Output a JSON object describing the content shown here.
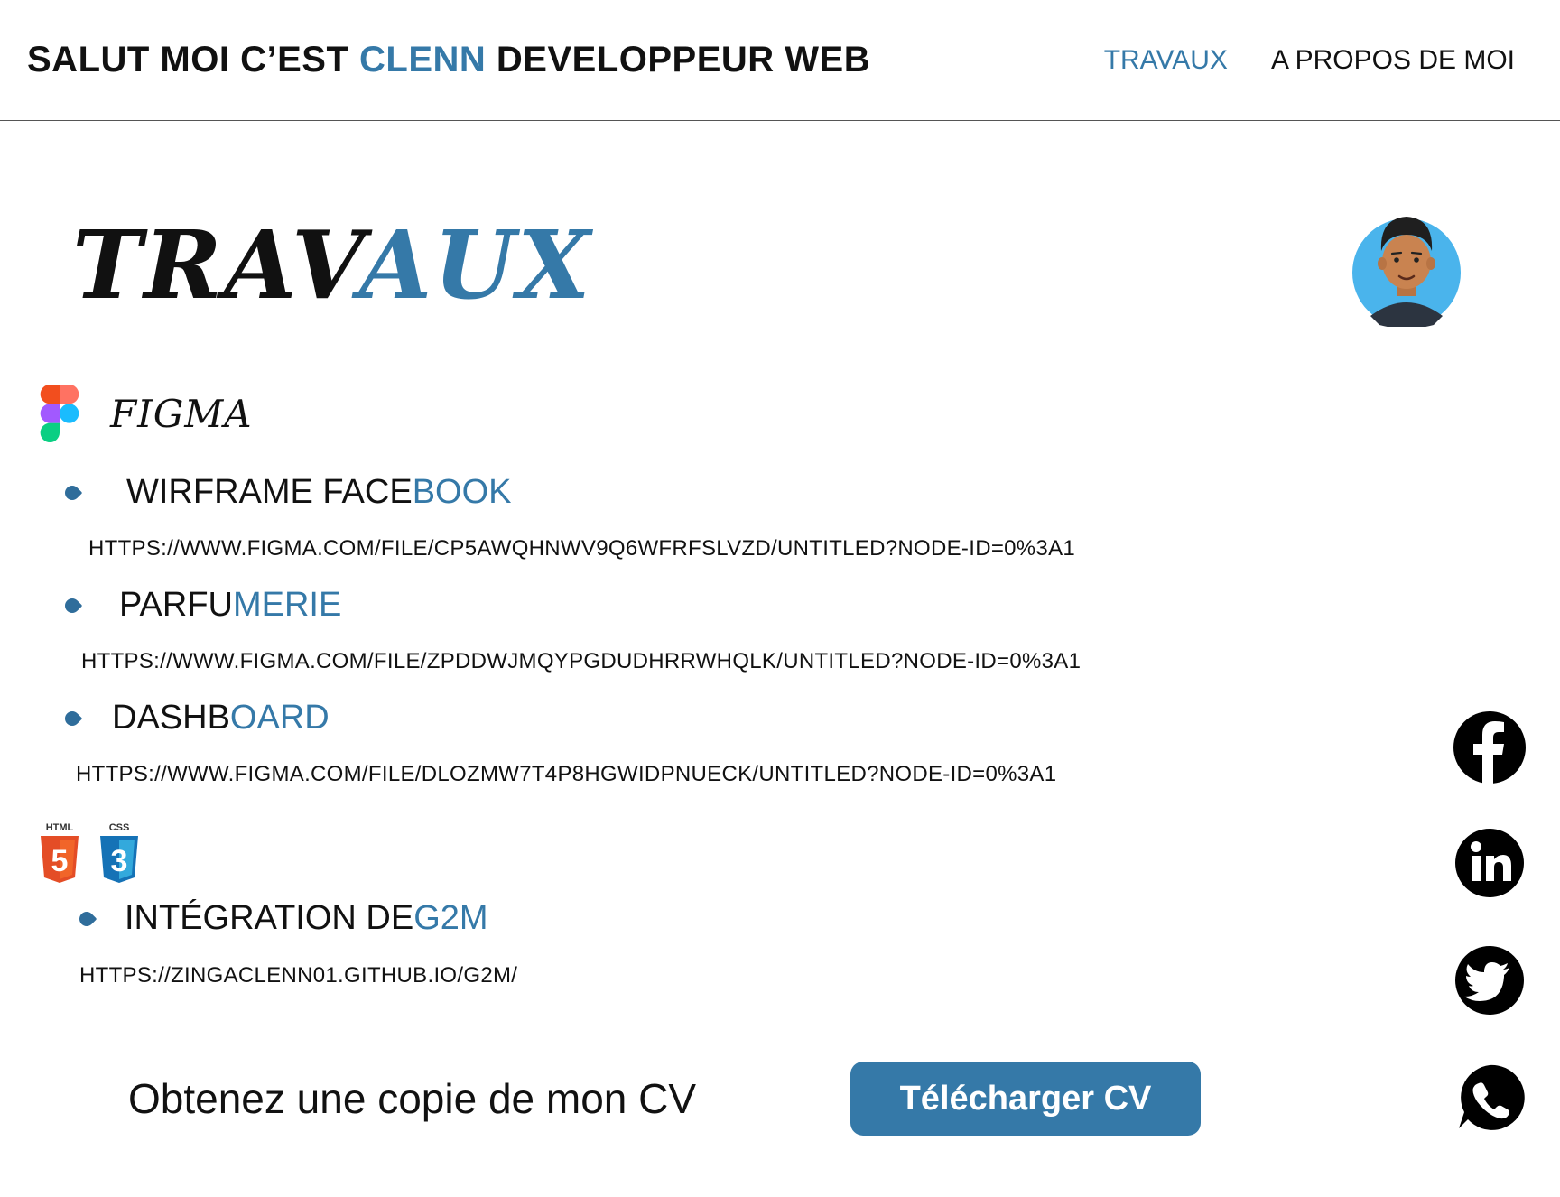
{
  "header": {
    "brand": {
      "part1": "SALUT MOI C’EST ",
      "name": "CLENN",
      "part2": "  DEVELOPPEUR WEB"
    },
    "nav": [
      {
        "label": "TRAVAUX",
        "active": true
      },
      {
        "label": "A PROPOS DE MOI",
        "active": false
      }
    ]
  },
  "page_title": {
    "part1": "TRAV",
    "part2": "AUX"
  },
  "sections": [
    {
      "label": "FIGMA",
      "icon": "figma-icon",
      "items": [
        {
          "title1": "WIRFRAME FACE",
          "title2": "BOOK",
          "link": "HTTPS://WWW.FIGMA.COM/FILE/CP5AWQHNWV9Q6WFRFSLVZD/UNTITLED?NODE-ID=0%3A1"
        },
        {
          "title1": "PARFU",
          "title2": "MERIE",
          "link": "HTTPS://WWW.FIGMA.COM/FILE/ZPDDWJMQYPGDUDHRRWHQLK/UNTITLED?NODE-ID=0%3A1"
        },
        {
          "title1": "DASHB",
          "title2": "OARD",
          "link": "HTTPS://WWW.FIGMA.COM/FILE/DLOZMW7T4P8HGWIDPNUECK/UNTITLED?NODE-ID=0%3A1"
        }
      ]
    },
    {
      "icons": [
        {
          "name": "html5-icon",
          "label": "HTML",
          "digit": "5"
        },
        {
          "name": "css3-icon",
          "label": "CSS",
          "digit": "3"
        }
      ],
      "items": [
        {
          "title1": "INTÉGRATION DE ",
          "title2": "G2M",
          "link": "HTTPS://ZINGACLENN01.GITHUB.IO/G2M/"
        }
      ]
    }
  ],
  "cv": {
    "text": "Obtenez une copie de mon CV",
    "button": "Télécharger CV"
  },
  "social": [
    "facebook-icon",
    "linkedin-icon",
    "twitter-icon",
    "whatsapp-icon"
  ],
  "colors": {
    "accent": "#3579a8",
    "text": "#111111",
    "avatar_bg": "#4ab4ec",
    "skin": "#c98350"
  }
}
